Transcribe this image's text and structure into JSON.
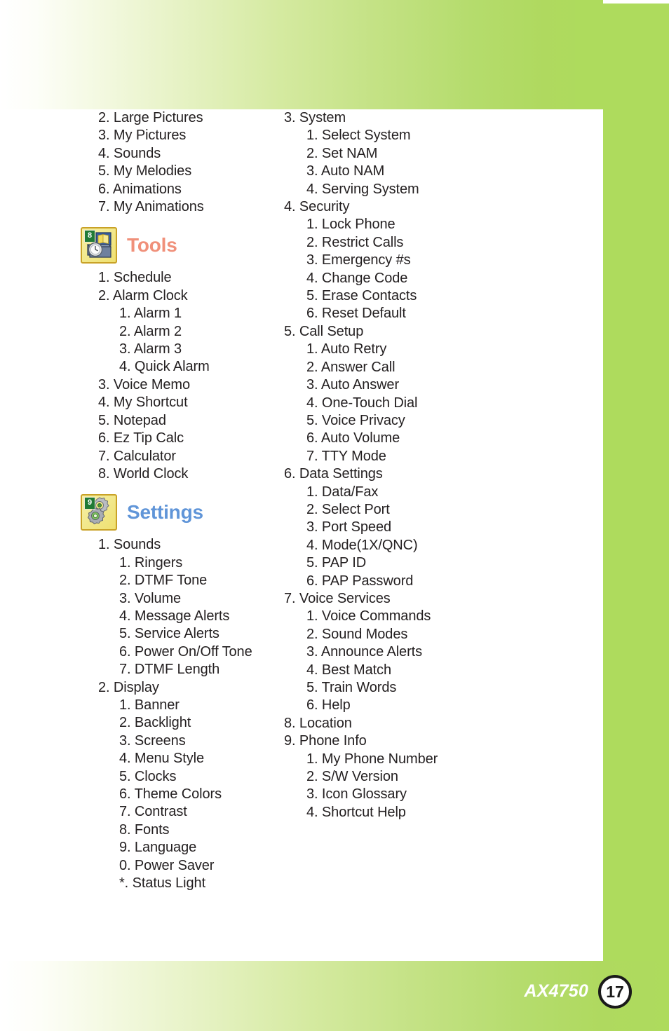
{
  "document": {
    "model_name": "AX4750",
    "page_number": "17"
  },
  "theme": {
    "band_green": "#aedb5d",
    "tools_heading_color": "#f0907a",
    "settings_heading_color": "#6095d8",
    "body_text_color": "#231f20",
    "icon_tile_yellow": "#f2e98f",
    "icon_badge_green": "#1f7a36"
  },
  "left_column": {
    "continued_list": [
      {
        "level": 1,
        "text": "2. Large Pictures"
      },
      {
        "level": 1,
        "text": "3. My Pictures"
      },
      {
        "level": 1,
        "text": "4. Sounds"
      },
      {
        "level": 1,
        "text": "5. My Melodies"
      },
      {
        "level": 1,
        "text": "6. Animations"
      },
      {
        "level": 1,
        "text": "7. My Animations"
      }
    ],
    "sections": [
      {
        "id": "tools",
        "title": "Tools",
        "icon": "toolbox-icon",
        "icon_badge": "8",
        "items": [
          {
            "level": 1,
            "text": "1. Schedule"
          },
          {
            "level": 1,
            "text": "2. Alarm Clock"
          },
          {
            "level": 2,
            "text": "1. Alarm 1"
          },
          {
            "level": 2,
            "text": "2. Alarm 2"
          },
          {
            "level": 2,
            "text": "3. Alarm 3"
          },
          {
            "level": 2,
            "text": "4. Quick Alarm"
          },
          {
            "level": 1,
            "text": "3. Voice Memo"
          },
          {
            "level": 1,
            "text": "4. My Shortcut"
          },
          {
            "level": 1,
            "text": "5. Notepad"
          },
          {
            "level": 1,
            "text": "6. Ez Tip Calc"
          },
          {
            "level": 1,
            "text": "7. Calculator"
          },
          {
            "level": 1,
            "text": "8. World Clock"
          }
        ]
      },
      {
        "id": "settings",
        "title": "Settings",
        "icon": "gears-icon",
        "icon_badge": "9",
        "items": [
          {
            "level": 1,
            "text": "1. Sounds"
          },
          {
            "level": 2,
            "text": "1. Ringers"
          },
          {
            "level": 2,
            "text": "2. DTMF Tone"
          },
          {
            "level": 2,
            "text": "3. Volume"
          },
          {
            "level": 2,
            "text": "4. Message Alerts"
          },
          {
            "level": 2,
            "text": "5. Service Alerts"
          },
          {
            "level": 2,
            "text": "6. Power On/Off Tone"
          },
          {
            "level": 2,
            "text": "7. DTMF Length"
          },
          {
            "level": 1,
            "text": "2. Display"
          },
          {
            "level": 2,
            "text": "1. Banner"
          },
          {
            "level": 2,
            "text": "2. Backlight"
          },
          {
            "level": 2,
            "text": "3. Screens"
          },
          {
            "level": 2,
            "text": "4. Menu Style"
          },
          {
            "level": 2,
            "text": "5. Clocks"
          },
          {
            "level": 2,
            "text": "6. Theme Colors"
          },
          {
            "level": 2,
            "text": "7. Contrast"
          },
          {
            "level": 2,
            "text": "8. Fonts"
          },
          {
            "level": 2,
            "text": "9. Language"
          },
          {
            "level": 2,
            "text": "0. Power Saver"
          },
          {
            "level": 2,
            "text": "*. Status Light"
          }
        ]
      }
    ]
  },
  "right_column": {
    "items": [
      {
        "level": 1,
        "text": "3. System"
      },
      {
        "level": 2,
        "text": "1. Select System"
      },
      {
        "level": 2,
        "text": "2. Set NAM"
      },
      {
        "level": 2,
        "text": "3. Auto NAM"
      },
      {
        "level": 2,
        "text": "4. Serving System"
      },
      {
        "level": 1,
        "text": "4. Security"
      },
      {
        "level": 2,
        "text": "1. Lock Phone"
      },
      {
        "level": 2,
        "text": "2. Restrict Calls"
      },
      {
        "level": 2,
        "text": "3. Emergency #s"
      },
      {
        "level": 2,
        "text": "4. Change Code"
      },
      {
        "level": 2,
        "text": "5. Erase Contacts"
      },
      {
        "level": 2,
        "text": "6. Reset Default"
      },
      {
        "level": 1,
        "text": "5. Call Setup"
      },
      {
        "level": 2,
        "text": "1. Auto Retry"
      },
      {
        "level": 2,
        "text": "2. Answer Call"
      },
      {
        "level": 2,
        "text": "3. Auto Answer"
      },
      {
        "level": 2,
        "text": "4. One-Touch Dial"
      },
      {
        "level": 2,
        "text": "5. Voice Privacy"
      },
      {
        "level": 2,
        "text": "6. Auto Volume"
      },
      {
        "level": 2,
        "text": "7. TTY Mode"
      },
      {
        "level": 1,
        "text": "6. Data Settings"
      },
      {
        "level": 2,
        "text": "1. Data/Fax"
      },
      {
        "level": 2,
        "text": "2. Select Port"
      },
      {
        "level": 2,
        "text": "3. Port Speed"
      },
      {
        "level": 2,
        "text": "4. Mode(1X/QNC)"
      },
      {
        "level": 2,
        "text": "5. PAP ID"
      },
      {
        "level": 2,
        "text": "6. PAP Password"
      },
      {
        "level": 1,
        "text": "7. Voice Services"
      },
      {
        "level": 2,
        "text": "1. Voice Commands"
      },
      {
        "level": 2,
        "text": "2. Sound Modes"
      },
      {
        "level": 2,
        "text": "3. Announce Alerts"
      },
      {
        "level": 2,
        "text": "4. Best Match"
      },
      {
        "level": 2,
        "text": "5. Train Words"
      },
      {
        "level": 2,
        "text": "6. Help"
      },
      {
        "level": 1,
        "text": "8. Location"
      },
      {
        "level": 1,
        "text": "9. Phone Info"
      },
      {
        "level": 2,
        "text": "1. My Phone Number"
      },
      {
        "level": 2,
        "text": "2. S/W Version"
      },
      {
        "level": 2,
        "text": "3. Icon Glossary"
      },
      {
        "level": 2,
        "text": "4. Shortcut Help"
      }
    ]
  }
}
